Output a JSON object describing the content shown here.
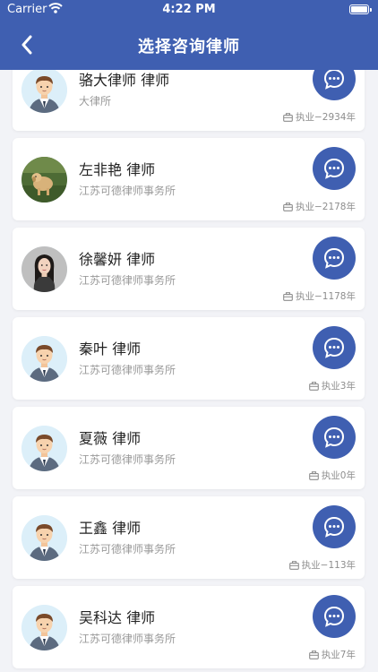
{
  "status_bar": {
    "carrier": "Carrier",
    "time": "4:22 PM"
  },
  "header": {
    "title": "选择咨询律师",
    "back_icon": "chevron-left-icon",
    "background_color": "#3f5fb1"
  },
  "lawyers": [
    {
      "name": "骆大律师 律师",
      "firm": "大律所",
      "years": "执业−2934年",
      "avatar": "cartoon-lawyer"
    },
    {
      "name": "左非艳 律师",
      "firm": "江苏可德律师事务所",
      "years": "执业−2178年",
      "avatar": "photo-dog-grass"
    },
    {
      "name": "徐馨妍 律师",
      "firm": "江苏可德律师事务所",
      "years": "执业−1178年",
      "avatar": "photo-woman"
    },
    {
      "name": "秦叶 律师",
      "firm": "江苏可德律师事务所",
      "years": "执业3年",
      "avatar": "cartoon-lawyer"
    },
    {
      "name": "夏薇 律师",
      "firm": "江苏可德律师事务所",
      "years": "执业0年",
      "avatar": "cartoon-lawyer"
    },
    {
      "name": "王鑫 律师",
      "firm": "江苏可德律师事务所",
      "years": "执业−113年",
      "avatar": "cartoon-lawyer"
    },
    {
      "name": "吴科达 律师",
      "firm": "江苏可德律师事务所",
      "years": "执业7年",
      "avatar": "cartoon-lawyer"
    }
  ],
  "chat_icon": "chat-bubble-icon",
  "briefcase_icon": "briefcase-icon"
}
